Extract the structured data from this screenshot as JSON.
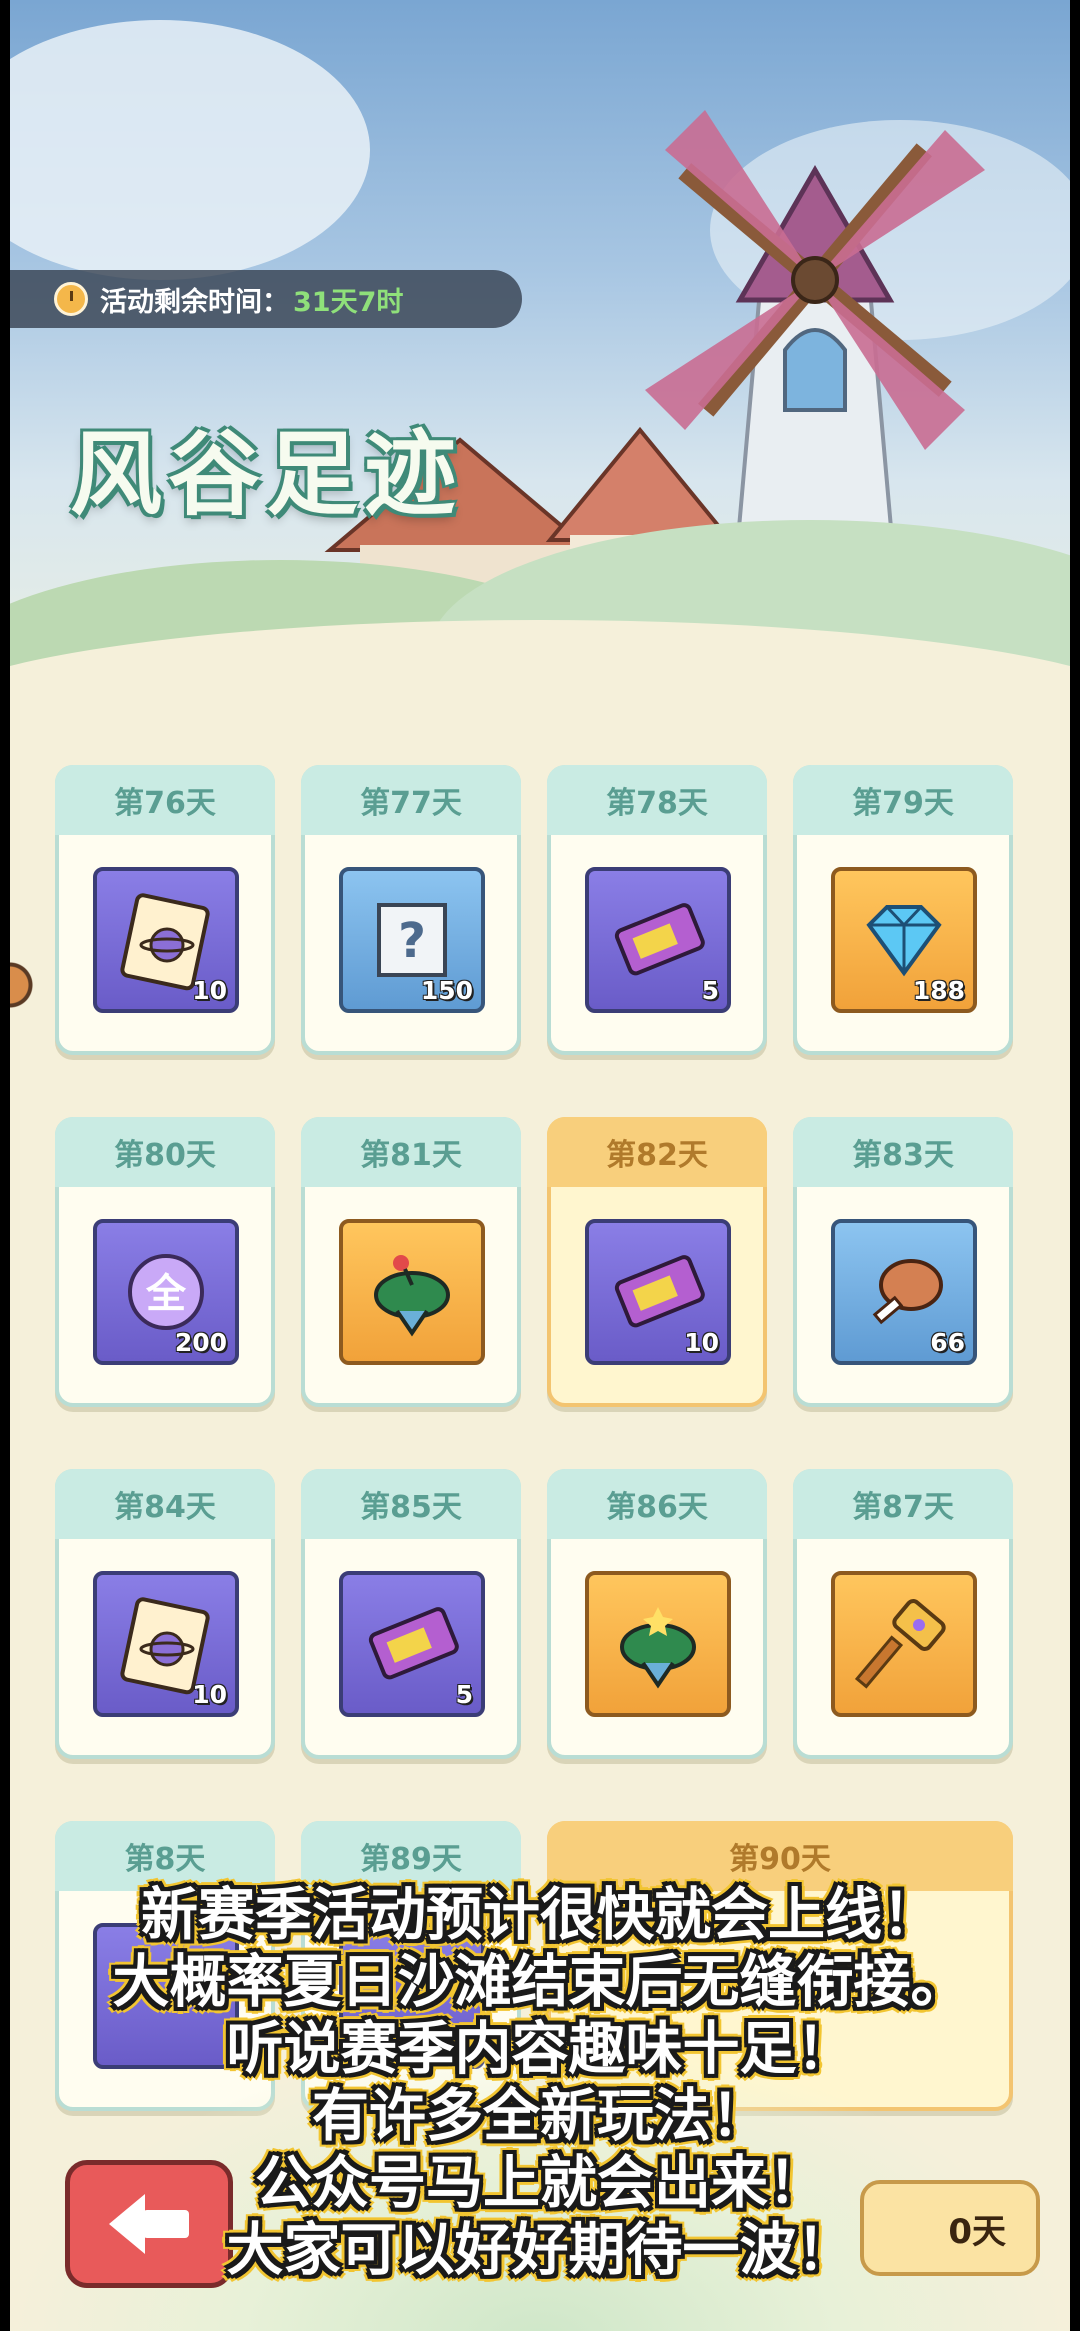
{
  "header": {
    "timer_label": "活动剩余时间：",
    "timer_value": "31天7时",
    "event_title": "风谷足迹"
  },
  "rewards": [
    {
      "day": "第76天",
      "item": "ticket-book",
      "qty": "10",
      "tile": "purple"
    },
    {
      "day": "第77天",
      "item": "mystery-scroll",
      "qty": "150",
      "tile": "blue"
    },
    {
      "day": "第78天",
      "item": "double-ticket",
      "qty": "5",
      "tile": "purple"
    },
    {
      "day": "第79天",
      "item": "diamond",
      "qty": "188",
      "tile": "orange"
    },
    {
      "day": "第80天",
      "item": "all-orb",
      "qty": "200",
      "tile": "purple",
      "orb_text": "全"
    },
    {
      "day": "第81天",
      "item": "spinning-top",
      "qty": "",
      "tile": "orange"
    },
    {
      "day": "第82天",
      "item": "double-ticket",
      "qty": "10",
      "tile": "purple",
      "highlight": true
    },
    {
      "day": "第83天",
      "item": "meat",
      "qty": "66",
      "tile": "blue"
    },
    {
      "day": "第84天",
      "item": "ticket-book",
      "qty": "10",
      "tile": "purple"
    },
    {
      "day": "第85天",
      "item": "double-ticket",
      "qty": "5",
      "tile": "purple"
    },
    {
      "day": "第86天",
      "item": "spinning-top",
      "qty": "",
      "tile": "orange"
    },
    {
      "day": "第87天",
      "item": "golden-hammer",
      "qty": "",
      "tile": "orange"
    },
    {
      "day": "第8天",
      "item": "",
      "qty": "",
      "tile": "purple"
    },
    {
      "day": "第89天",
      "item": "",
      "qty": "",
      "tile": "purple"
    },
    {
      "day": "第90天",
      "item": "",
      "qty": "",
      "tile": "orange"
    }
  ],
  "footer": {
    "claim_label": "0天"
  },
  "subtitles": [
    "新赛季活动预计很快就会上线！",
    "大概率夏日沙滩结束后无缝衔接。",
    "听说赛季内容趣味十足！",
    "有许多全新玩法！",
    "公众号马上就会出来！",
    "大家可以好好期待一波！"
  ],
  "colors": {
    "accent_green": "#8fe07a",
    "card_header": "#c9ebe3",
    "highlight_gold": "#f8cf7c",
    "subtitle_outline": "#f2c531",
    "back_button": "#e85a5a"
  }
}
